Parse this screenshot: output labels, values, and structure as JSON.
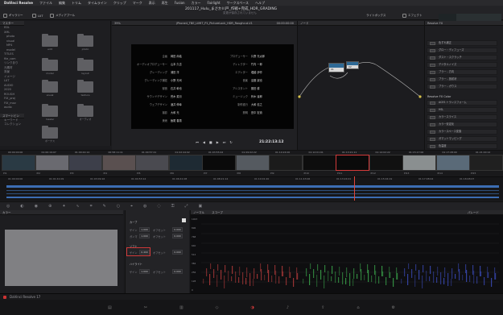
{
  "menubar": {
    "app": "DaVinci Resolve",
    "items": [
      "ファイル",
      "編集",
      "トリム",
      "タイムライン",
      "クリップ",
      "マーク",
      "表示",
      "再生",
      "Fusion",
      "カラー",
      "Fairlight",
      "ワークスペース",
      "ヘルプ"
    ]
  },
  "window": {
    "title": "201117_Hulu_まさか川戸_作戦+完成_HDR_GRADING",
    "subtitle": "変更が保存されていません"
  },
  "toolbar": {
    "gallery": "ギャラリー",
    "luts": "LUT",
    "media_pool": "メディアプール",
    "clips": "クリップ",
    "nodes": "ノード",
    "lightbox": "ライトボックス",
    "effects": "エフェクト"
  },
  "left_panel": {
    "header": "マスター",
    "items": [
      "EDL",
      "XML",
      "photo",
      "visual",
      "MP4",
      "model",
      "TITLES",
      "file_cam",
      "リンクあり",
      "元素材",
      "背景",
      "イメージ",
      "LUT",
      "AUDIO",
      "2020",
      "ROUGH",
      "FIX_proj",
      "FIX_mov",
      "audio"
    ],
    "smart_bins": "スマートビン",
    "smart_items": [
      "キーワード",
      "コレクション"
    ]
  },
  "folders": [
    "edit",
    "photo",
    "model",
    "layout",
    "visual",
    "texture",
    "master",
    "オーディオ",
    "ボーナス"
  ],
  "viewer": {
    "zoom": "39%",
    "clip_name": "jPhone4_TBE_LIMIT_P1_PictureLock_HDR_Roughcut-V1",
    "timecode_top": "00:00:00:00",
    "timecode": "21:22:13:12"
  },
  "credits": [
    {
      "role": "企画",
      "name": "岡田 尚義"
    },
    {
      "role": "プロデューサー",
      "name": "片野 光太郎"
    },
    {
      "role": "オーディオプロデューサー",
      "name": "山本 久志"
    },
    {
      "role": "ディレクター",
      "name": "竹内 一郎"
    },
    {
      "role": "グレーディング",
      "name": "浦田 洋"
    },
    {
      "role": "エディター",
      "name": "堀越 伊作"
    },
    {
      "role": "グレーディング補佐",
      "name": "小野 光司"
    },
    {
      "role": "音楽",
      "name": "遠藤 誠也"
    },
    {
      "role": "録音",
      "name": "石井 幹也"
    },
    {
      "role": "アシスタント",
      "name": "藤田 耕"
    },
    {
      "role": "サウンドデザイン",
      "name": "荒木 菜月"
    },
    {
      "role": "ミュージック",
      "name": "鈴木 達郎"
    },
    {
      "role": "ウェブデザイン",
      "name": "酒井 伸幸"
    },
    {
      "role": "制作進行",
      "name": "大和 信之"
    },
    {
      "role": "撮影",
      "name": "大和 光"
    },
    {
      "role": "照明",
      "name": "田中 宏貴"
    },
    {
      "role": "美術",
      "name": "飯尾 春香"
    }
  ],
  "nodes": {
    "n1": "01",
    "n2": "02"
  },
  "right_panel": {
    "header": "ライブラリー",
    "tab": "Resolve FX",
    "section1": "Resolve FX Color",
    "items_top": [
      "色ずれ補正",
      "グロー・ディフューズ",
      "ダスト・スクラッチ",
      "デジタルノイズ",
      "ブラー - 方向",
      "ブラー - 放射状",
      "ブラー - ガウス"
    ],
    "items_bottom": [
      "ACES トランスフォーム",
      "HSL",
      "カラースライス",
      "カラー安定化",
      "カラースペース変換",
      "ガマットマッピング",
      "色温度"
    ]
  },
  "timeline": {
    "clip_codes": [
      "00:00:00:00",
      "01:00:19:07",
      "01:00:44:14",
      "00:58:11:11",
      "01:00:57:21",
      "01:02:44:02",
      "01:03:55:02",
      "01:09:02:22",
      "01:10:24:00",
      "01:12:01:01",
      "01:13:21:11",
      "01:14:02:22",
      "01:15:17:00",
      "01:17:28:00",
      "01:21:00:12"
    ],
    "clip_labels": [
      "Pl1",
      "Pl2",
      "Pl3",
      "Pl4",
      "Pl5",
      "Pl6",
      "Pl7",
      "Pl8",
      "Pl9",
      "Pl10",
      "Pl11",
      "Pl12",
      "Pl13",
      "Pl14",
      "Pl15"
    ],
    "ruler_labels": [
      "01:00:00:00",
      "01:01:41:09",
      "01:03:09:16",
      "01:04:53:14",
      "01:06:41:08",
      "01:08:21:14",
      "01:10:01:20",
      "01:11:43:06",
      "01:13:24:01",
      "01:15:04:19",
      "01:17:08:04",
      "01:18:48:07"
    ],
    "tracks": [
      "V3",
      "V2",
      "V1",
      "A1"
    ]
  },
  "color_panel": {
    "left_tab": "カラー",
    "mode_a": "ノーマル",
    "mode_b": "スコープ",
    "group1": "カーブ",
    "group2": "ソフト",
    "group3": "ハイライト",
    "rows": [
      {
        "label": "ゲイン",
        "v1": "1.000",
        "label2": "オフセット",
        "v2": "0.000"
      },
      {
        "label": "ガンマ",
        "v1": "1.000",
        "label2": "オフセット",
        "v2": "0.000"
      }
    ],
    "highlight_label": "ゲイン",
    "highlight_value": "0.400",
    "highlight_label2": "オフセット",
    "highlight_value2": "0.000",
    "bottom_row": {
      "label": "ゲイン",
      "v1": "1.000",
      "label2": "オフセット",
      "v2": "0.000"
    },
    "scope_title": "パレード",
    "scope_ticks": [
      "1023",
      "896",
      "768",
      "640",
      "512",
      "384",
      "256",
      "128",
      "0"
    ]
  },
  "statusbar": {
    "app": "DaVinci Resolve 17"
  },
  "webcam": {
    "description_color": "#2a3a3f"
  },
  "colors": {
    "accent": "#3c6db3",
    "highlight_box": "#d23a3a",
    "playhead": "#e0453a"
  }
}
